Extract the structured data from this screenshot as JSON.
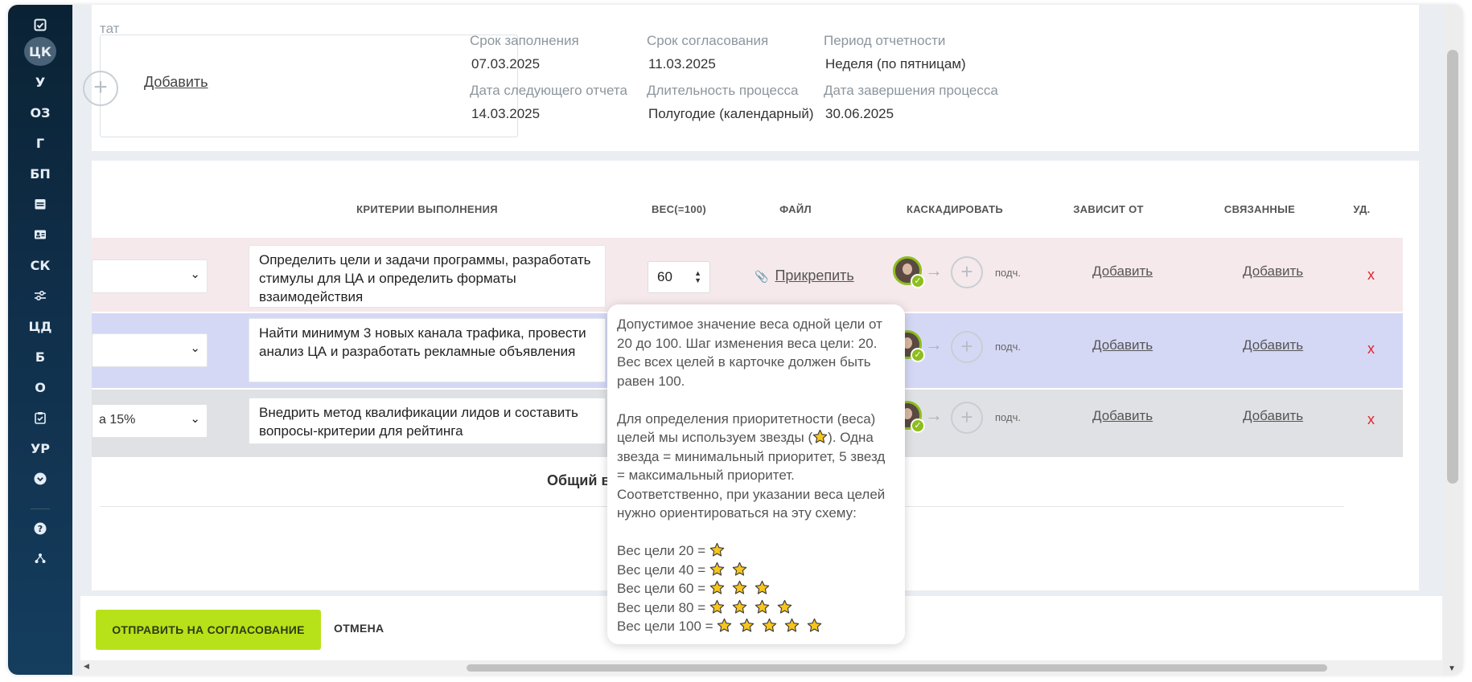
{
  "sidebar": {
    "items": [
      {
        "label": "",
        "icon": "checkbox-icon"
      },
      {
        "label": "ЦК",
        "active": true
      },
      {
        "label": "У"
      },
      {
        "label": "ОЗ"
      },
      {
        "label": "Г"
      },
      {
        "label": "БП"
      },
      {
        "label": "",
        "icon": "calendar-icon"
      },
      {
        "label": "",
        "icon": "id-card-icon"
      },
      {
        "label": "СК"
      },
      {
        "label": "",
        "icon": "sliders-icon"
      },
      {
        "label": "ЦД"
      },
      {
        "label": "Б"
      },
      {
        "label": "О"
      },
      {
        "label": "",
        "icon": "clipboard-icon"
      },
      {
        "label": "УР"
      },
      {
        "label": "",
        "icon": "chevron-down-circle-icon"
      },
      {
        "label": "",
        "icon": "help-icon"
      },
      {
        "label": "",
        "icon": "network-icon"
      }
    ]
  },
  "header": {
    "partial_label": "тат",
    "add_link": "Добавить",
    "fields": [
      {
        "label": "Срок заполнения",
        "value": "07.03.2025"
      },
      {
        "label": "Срок согласования",
        "value": "11.03.2025"
      },
      {
        "label": "Период отчетности",
        "value": "Неделя (по пятницам)"
      },
      {
        "label": "Дата следующего отчета",
        "value": "14.03.2025"
      },
      {
        "label": "Длительность процесса",
        "value": "Полугодие (календарный)"
      },
      {
        "label": "Дата завершения процесса",
        "value": "30.06.2025"
      }
    ]
  },
  "table": {
    "columns": {
      "criteria": "КРИТЕРИИ ВЫПОЛНЕНИЯ",
      "weight": "ВЕС(=100)",
      "file": "ФАЙЛ",
      "cascade": "КАСКАДИРОВАТЬ",
      "depends": "ЗАВИСИТ ОТ",
      "related": "СВЯЗАННЫЕ",
      "delete": "УД."
    },
    "rows": [
      {
        "select_value": "",
        "criteria": "Определить цели и задачи программы, разработать стимулы для ЦА и определить форматы взаимодействия",
        "weight": "60",
        "attach": "Прикрепить",
        "sub_label": "подч.",
        "depends": "Добавить",
        "related": "Добавить",
        "delete": "x"
      },
      {
        "select_value": "",
        "criteria": "Найти минимум 3 новых канала трафика, провести анализ ЦА и разработать рекламные объявления",
        "sub_label": "подч.",
        "depends": "Добавить",
        "related": "Добавить",
        "delete": "x"
      },
      {
        "select_value": "а 15%",
        "criteria": "Внедрить метод квалификации лидов и составить вопросы-критерии для рейтинга",
        "sub_label": "подч.",
        "depends": "Добавить",
        "related": "Добавить",
        "delete": "x"
      }
    ],
    "total_label": "Общий в"
  },
  "tooltip": {
    "p1": "Допустимое значение веса одной цели от 20 до 100. Шаг изменения веса цели: 20. Вес всех целей в карточке должен быть равен 100.",
    "p2_before": "Для определения приоритетности (веса) целей мы используем звезды (",
    "p2_after": "). Одна звезда = минимальный приоритет, 5 звезд = максимальный приоритет. Соответственно, при указании веса целей нужно ориентироваться на эту схему:",
    "scale": [
      {
        "label": "Вес цели 20 =",
        "stars": 1
      },
      {
        "label": "Вес цели 40 =",
        "stars": 2
      },
      {
        "label": "Вес цели 60 =",
        "stars": 3
      },
      {
        "label": "Вес цели 80 =",
        "stars": 4
      },
      {
        "label": "Вес цели 100 =",
        "stars": 5
      }
    ]
  },
  "footer": {
    "send_label": "ОТПРАВИТЬ НА СОГЛАСОВАНИЕ",
    "cancel_label": "ОТМЕНА"
  },
  "colors": {
    "accent": "#b7e21a",
    "sidebar": "#0e2a42",
    "row1": "#f6e9eb",
    "row2": "#d5d8f5",
    "row3": "#dfe1e4",
    "delete": "#e1252b",
    "star": "#f7c51d"
  }
}
